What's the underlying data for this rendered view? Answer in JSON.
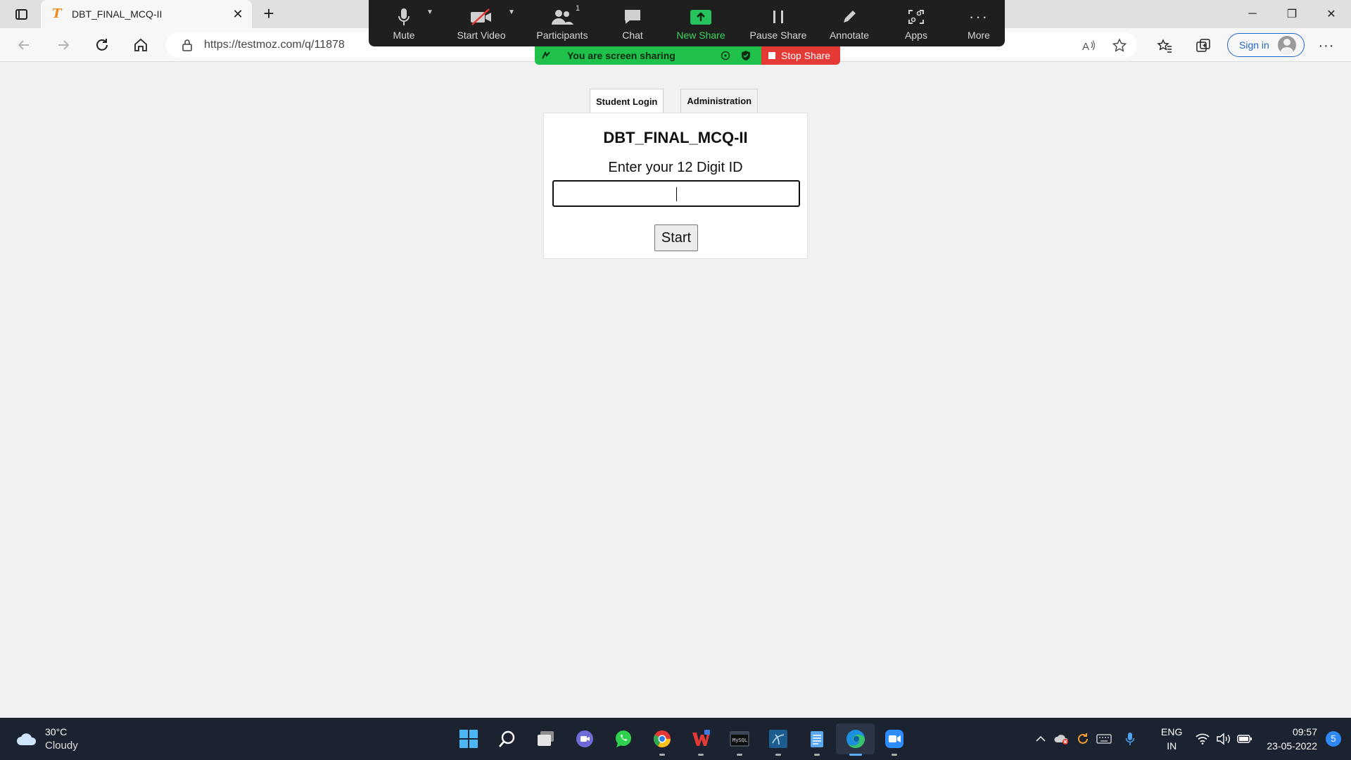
{
  "browser": {
    "tab_title": "DBT_FINAL_MCQ-II",
    "favicon_letter": "T",
    "url": "https://testmoz.com/q/11878",
    "signin_label": "Sign in"
  },
  "zoom": {
    "items": [
      {
        "label": "Mute",
        "icon": "microphone-icon"
      },
      {
        "label": "Start Video",
        "icon": "video-off-icon"
      },
      {
        "label": "Participants",
        "icon": "participants-icon",
        "badge": "1"
      },
      {
        "label": "Chat",
        "icon": "chat-icon"
      },
      {
        "label": "New Share",
        "icon": "share-icon"
      },
      {
        "label": "Pause Share",
        "icon": "pause-icon"
      },
      {
        "label": "Annotate",
        "icon": "pencil-icon"
      },
      {
        "label": "Apps",
        "icon": "apps-icon"
      },
      {
        "label": "More",
        "icon": "more-icon"
      }
    ],
    "sharing_label": "You are screen sharing",
    "stop_share_label": "Stop Share",
    "colors": {
      "toolbar": "#1f1f1f",
      "share_green": "#1fc14a",
      "stop_red": "#e53935"
    }
  },
  "page": {
    "tabs": [
      {
        "label": "Student Login",
        "active": true
      },
      {
        "label": "Administration",
        "active": false
      }
    ],
    "quiz_title": "DBT_FINAL_MCQ-II",
    "id_prompt": "Enter your 12 Digit ID",
    "id_value": "",
    "start_label": "Start"
  },
  "taskbar": {
    "weather_temp": "30°C",
    "weather_condition": "Cloudy",
    "language_top": "ENG",
    "language_bottom": "IN",
    "time": "09:57",
    "date": "23-05-2022",
    "notification_count": "5",
    "pinned_apps": [
      "start-icon",
      "search-icon",
      "task-view-icon",
      "teams-chat-icon",
      "whatsapp-icon",
      "chrome-icon",
      "wps-office-icon",
      "mysql-icon",
      "sql-workbench-icon",
      "notepad-icon",
      "edge-icon",
      "zoom-icon"
    ]
  }
}
